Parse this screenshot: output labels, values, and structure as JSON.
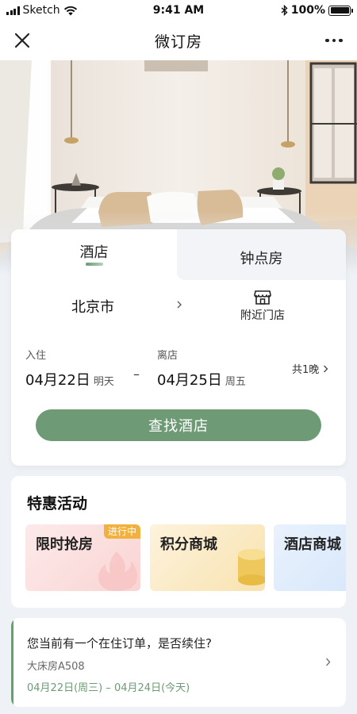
{
  "status_bar": {
    "carrier": "Sketch",
    "time": "9:41 AM",
    "battery": "100%"
  },
  "nav": {
    "title": "微订房"
  },
  "booking": {
    "tabs": [
      {
        "label": "酒店"
      },
      {
        "label": "钟点房"
      }
    ],
    "city": "北京市",
    "nearby_label": "附近门店",
    "checkin": {
      "label": "入住",
      "date": "04月22日",
      "weekday": "明天"
    },
    "checkout": {
      "label": "离店",
      "date": "04月25日",
      "weekday": "周五"
    },
    "separator": "–",
    "nights": "共1晚",
    "search_button": "查找酒店"
  },
  "promo": {
    "title": "特惠活动",
    "cards": [
      {
        "title": "限时抢房",
        "badge": "进行中"
      },
      {
        "title": "积分商城"
      },
      {
        "title": "酒店商城"
      }
    ]
  },
  "order": {
    "question": "您当前有一个在住订单，是否续住?",
    "room": "大床房A508",
    "dates": "04月22日(周三) – 04月24日(今天)"
  },
  "colors": {
    "accent": "#6e9b76",
    "badge": "#f2b13c",
    "page_bg": "#eef1f6"
  },
  "icons": {
    "close": "close-icon",
    "more": "more-icon",
    "store": "store-icon",
    "chevron": "chevron-right-icon"
  }
}
